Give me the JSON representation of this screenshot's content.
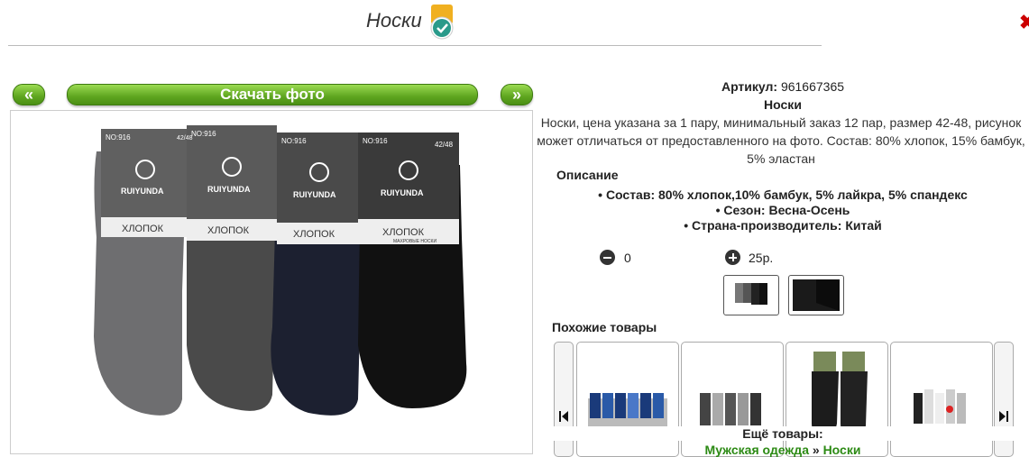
{
  "page": {
    "title": "Носки"
  },
  "nav": {
    "prev_label": "«",
    "download_label": "Скачать фото",
    "next_label": "»"
  },
  "product": {
    "article_label": "Артикул:",
    "article_value": "961667365",
    "name": "Носки",
    "description": "Носки, цена указана за 1 пару, минимальный заказ 12 пар, размер 42-48, рисунок может отличаться от предоставленного на фото. Состав: 80% хлопок, 15% бамбук, 5% эластан",
    "desc_heading": "Описание",
    "specs": [
      "Состав: 80% хлопок,10% бамбук, 5% лайкра, 5% спандекс",
      "Сезон: Весна-Осень",
      "Страна-производитель: Китай"
    ]
  },
  "photo": {
    "brand": "RUIYUNDA",
    "model": "NO:916",
    "size": "42/48",
    "material": "ХЛОПОК",
    "subtitle": "МАХРОВЫЕ НОСКИ"
  },
  "order": {
    "quantity": "0",
    "price": "25р."
  },
  "similar": {
    "heading": "Похожие товары"
  },
  "more": {
    "heading": "Ещё товары:",
    "link1": "Мужская одежда",
    "separator": " » ",
    "link2": "Носки"
  },
  "colors": {
    "accent_green": "#5ea51f",
    "link_green": "#2c8a14",
    "badge_check": "#2a9a8a"
  },
  "icons": [
    "check-badge-icon",
    "minus-circle-icon",
    "plus-circle-icon",
    "carousel-prev-icon",
    "carousel-next-icon"
  ]
}
